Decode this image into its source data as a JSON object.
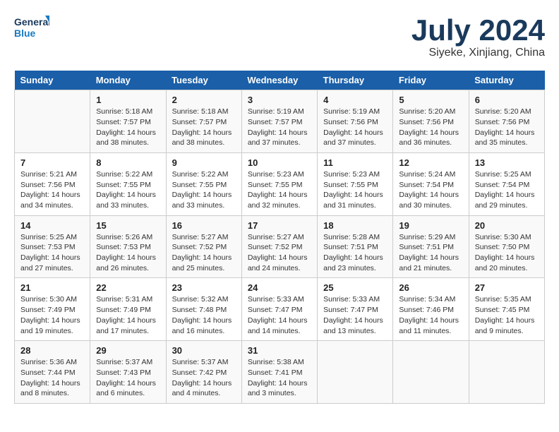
{
  "logo": {
    "text_general": "General",
    "text_blue": "Blue"
  },
  "title": "July 2024",
  "location": "Siyeke, Xinjiang, China",
  "days_of_week": [
    "Sunday",
    "Monday",
    "Tuesday",
    "Wednesday",
    "Thursday",
    "Friday",
    "Saturday"
  ],
  "weeks": [
    [
      {
        "day": "",
        "sunrise": "",
        "sunset": "",
        "daylight": ""
      },
      {
        "day": "1",
        "sunrise": "Sunrise: 5:18 AM",
        "sunset": "Sunset: 7:57 PM",
        "daylight": "Daylight: 14 hours and 38 minutes."
      },
      {
        "day": "2",
        "sunrise": "Sunrise: 5:18 AM",
        "sunset": "Sunset: 7:57 PM",
        "daylight": "Daylight: 14 hours and 38 minutes."
      },
      {
        "day": "3",
        "sunrise": "Sunrise: 5:19 AM",
        "sunset": "Sunset: 7:57 PM",
        "daylight": "Daylight: 14 hours and 37 minutes."
      },
      {
        "day": "4",
        "sunrise": "Sunrise: 5:19 AM",
        "sunset": "Sunset: 7:56 PM",
        "daylight": "Daylight: 14 hours and 37 minutes."
      },
      {
        "day": "5",
        "sunrise": "Sunrise: 5:20 AM",
        "sunset": "Sunset: 7:56 PM",
        "daylight": "Daylight: 14 hours and 36 minutes."
      },
      {
        "day": "6",
        "sunrise": "Sunrise: 5:20 AM",
        "sunset": "Sunset: 7:56 PM",
        "daylight": "Daylight: 14 hours and 35 minutes."
      }
    ],
    [
      {
        "day": "7",
        "sunrise": "Sunrise: 5:21 AM",
        "sunset": "Sunset: 7:56 PM",
        "daylight": "Daylight: 14 hours and 34 minutes."
      },
      {
        "day": "8",
        "sunrise": "Sunrise: 5:22 AM",
        "sunset": "Sunset: 7:55 PM",
        "daylight": "Daylight: 14 hours and 33 minutes."
      },
      {
        "day": "9",
        "sunrise": "Sunrise: 5:22 AM",
        "sunset": "Sunset: 7:55 PM",
        "daylight": "Daylight: 14 hours and 33 minutes."
      },
      {
        "day": "10",
        "sunrise": "Sunrise: 5:23 AM",
        "sunset": "Sunset: 7:55 PM",
        "daylight": "Daylight: 14 hours and 32 minutes."
      },
      {
        "day": "11",
        "sunrise": "Sunrise: 5:23 AM",
        "sunset": "Sunset: 7:55 PM",
        "daylight": "Daylight: 14 hours and 31 minutes."
      },
      {
        "day": "12",
        "sunrise": "Sunrise: 5:24 AM",
        "sunset": "Sunset: 7:54 PM",
        "daylight": "Daylight: 14 hours and 30 minutes."
      },
      {
        "day": "13",
        "sunrise": "Sunrise: 5:25 AM",
        "sunset": "Sunset: 7:54 PM",
        "daylight": "Daylight: 14 hours and 29 minutes."
      }
    ],
    [
      {
        "day": "14",
        "sunrise": "Sunrise: 5:25 AM",
        "sunset": "Sunset: 7:53 PM",
        "daylight": "Daylight: 14 hours and 27 minutes."
      },
      {
        "day": "15",
        "sunrise": "Sunrise: 5:26 AM",
        "sunset": "Sunset: 7:53 PM",
        "daylight": "Daylight: 14 hours and 26 minutes."
      },
      {
        "day": "16",
        "sunrise": "Sunrise: 5:27 AM",
        "sunset": "Sunset: 7:52 PM",
        "daylight": "Daylight: 14 hours and 25 minutes."
      },
      {
        "day": "17",
        "sunrise": "Sunrise: 5:27 AM",
        "sunset": "Sunset: 7:52 PM",
        "daylight": "Daylight: 14 hours and 24 minutes."
      },
      {
        "day": "18",
        "sunrise": "Sunrise: 5:28 AM",
        "sunset": "Sunset: 7:51 PM",
        "daylight": "Daylight: 14 hours and 23 minutes."
      },
      {
        "day": "19",
        "sunrise": "Sunrise: 5:29 AM",
        "sunset": "Sunset: 7:51 PM",
        "daylight": "Daylight: 14 hours and 21 minutes."
      },
      {
        "day": "20",
        "sunrise": "Sunrise: 5:30 AM",
        "sunset": "Sunset: 7:50 PM",
        "daylight": "Daylight: 14 hours and 20 minutes."
      }
    ],
    [
      {
        "day": "21",
        "sunrise": "Sunrise: 5:30 AM",
        "sunset": "Sunset: 7:49 PM",
        "daylight": "Daylight: 14 hours and 19 minutes."
      },
      {
        "day": "22",
        "sunrise": "Sunrise: 5:31 AM",
        "sunset": "Sunset: 7:49 PM",
        "daylight": "Daylight: 14 hours and 17 minutes."
      },
      {
        "day": "23",
        "sunrise": "Sunrise: 5:32 AM",
        "sunset": "Sunset: 7:48 PM",
        "daylight": "Daylight: 14 hours and 16 minutes."
      },
      {
        "day": "24",
        "sunrise": "Sunrise: 5:33 AM",
        "sunset": "Sunset: 7:47 PM",
        "daylight": "Daylight: 14 hours and 14 minutes."
      },
      {
        "day": "25",
        "sunrise": "Sunrise: 5:33 AM",
        "sunset": "Sunset: 7:47 PM",
        "daylight": "Daylight: 14 hours and 13 minutes."
      },
      {
        "day": "26",
        "sunrise": "Sunrise: 5:34 AM",
        "sunset": "Sunset: 7:46 PM",
        "daylight": "Daylight: 14 hours and 11 minutes."
      },
      {
        "day": "27",
        "sunrise": "Sunrise: 5:35 AM",
        "sunset": "Sunset: 7:45 PM",
        "daylight": "Daylight: 14 hours and 9 minutes."
      }
    ],
    [
      {
        "day": "28",
        "sunrise": "Sunrise: 5:36 AM",
        "sunset": "Sunset: 7:44 PM",
        "daylight": "Daylight: 14 hours and 8 minutes."
      },
      {
        "day": "29",
        "sunrise": "Sunrise: 5:37 AM",
        "sunset": "Sunset: 7:43 PM",
        "daylight": "Daylight: 14 hours and 6 minutes."
      },
      {
        "day": "30",
        "sunrise": "Sunrise: 5:37 AM",
        "sunset": "Sunset: 7:42 PM",
        "daylight": "Daylight: 14 hours and 4 minutes."
      },
      {
        "day": "31",
        "sunrise": "Sunrise: 5:38 AM",
        "sunset": "Sunset: 7:41 PM",
        "daylight": "Daylight: 14 hours and 3 minutes."
      },
      {
        "day": "",
        "sunrise": "",
        "sunset": "",
        "daylight": ""
      },
      {
        "day": "",
        "sunrise": "",
        "sunset": "",
        "daylight": ""
      },
      {
        "day": "",
        "sunrise": "",
        "sunset": "",
        "daylight": ""
      }
    ]
  ]
}
